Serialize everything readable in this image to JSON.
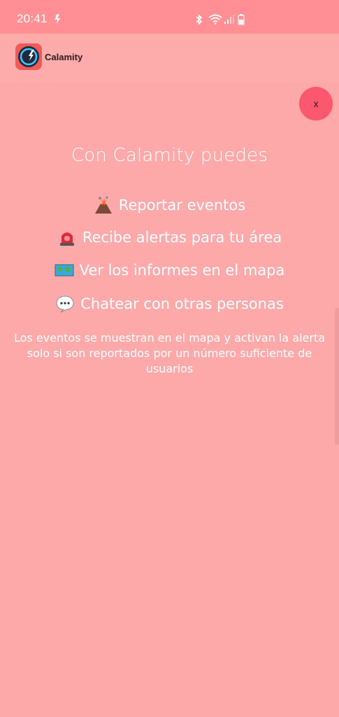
{
  "status_bar": {
    "time": "20:41",
    "icons": [
      "notification-icon",
      "bluetooth-icon",
      "wifi-icon",
      "signal-icon",
      "battery-icon"
    ]
  },
  "header": {
    "app_name": "Calamity",
    "logo_icon": "calamity-logo-icon"
  },
  "dialog": {
    "close_label": "x",
    "title": "Con Calamity puedes",
    "features": [
      {
        "icon": "volcano-icon",
        "label": "Reportar eventos"
      },
      {
        "icon": "siren-icon",
        "label": "Recibe alertas para tu área"
      },
      {
        "icon": "map-icon",
        "label": "Ver los informes en el mapa"
      },
      {
        "icon": "speech-bubble-icon",
        "label": "Chatear con otras personas"
      }
    ],
    "info": "Los eventos se muestran en el mapa y activan la alerta solo si son reportados por un número suficiente de usuarios"
  },
  "colors": {
    "background": "#fda9aa",
    "status_bar": "#ff8f94",
    "close_button": "#fb576e",
    "text": "#ffffff"
  }
}
